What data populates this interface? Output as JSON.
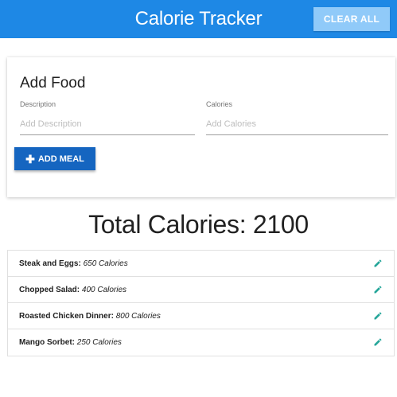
{
  "header": {
    "brand": "Calorie Tracker",
    "clear_all_label": "CLEAR ALL"
  },
  "form": {
    "title": "Add Food",
    "description_label": "Description",
    "description_placeholder": "Add Description",
    "calories_label": "Calories",
    "calories_placeholder": "Add Calories",
    "add_button_icon": "plus-icon",
    "add_button_label": "ADD MEAL"
  },
  "total": {
    "text": "Total Calories: 2100"
  },
  "meals": [
    {
      "name": "Steak and Eggs:",
      "calories": "650 Calories",
      "icon": "pencil-icon"
    },
    {
      "name": "Chopped Salad:",
      "calories": "400 Calories",
      "icon": "pencil-icon"
    },
    {
      "name": "Roasted Chicken Dinner:",
      "calories": "800 Calories",
      "icon": "pencil-icon"
    },
    {
      "name": "Mango Sorbet:",
      "calories": "250 Calories",
      "icon": "pencil-icon"
    }
  ],
  "colors": {
    "navbar": "#1e88e5",
    "clear_button": "#90caf9",
    "add_button": "#1565c0",
    "edit_icon": "#26a69a"
  }
}
